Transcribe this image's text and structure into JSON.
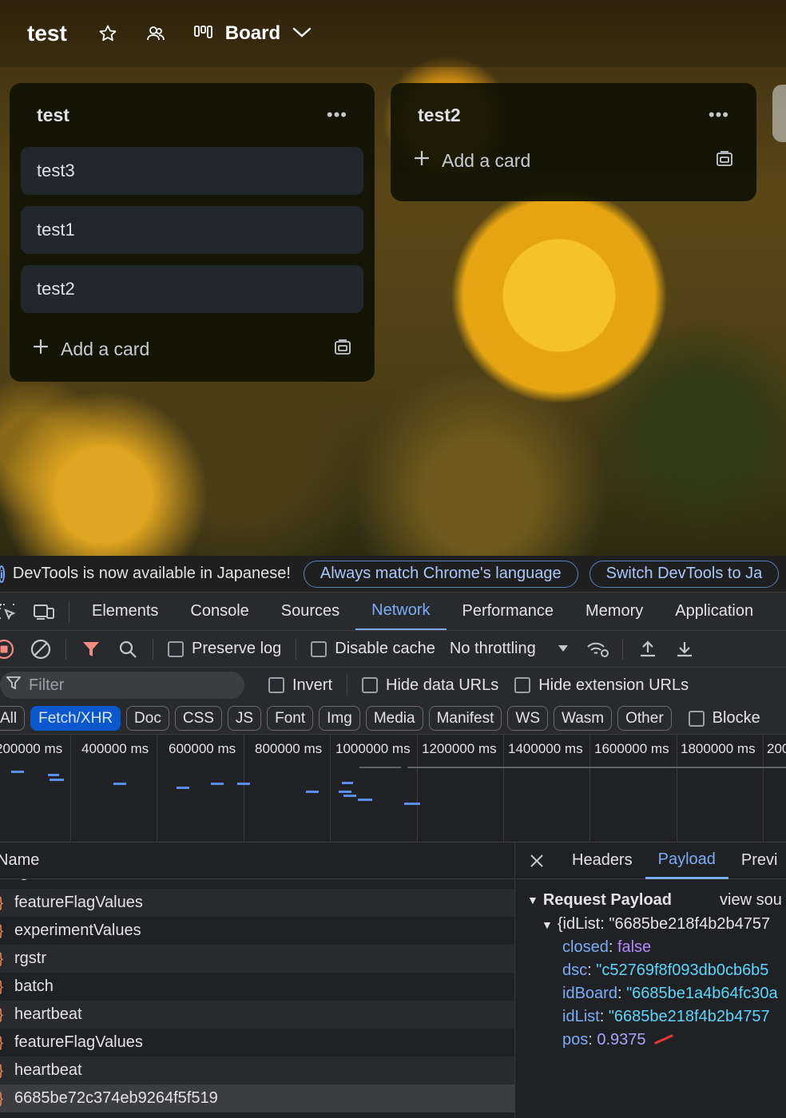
{
  "board": {
    "title": "test",
    "view_label": "Board",
    "lists": [
      {
        "title": "test",
        "cards": [
          "test3",
          "test1",
          "test2"
        ],
        "add_label": "Add a card"
      },
      {
        "title": "test2",
        "cards": [],
        "add_label": "Add a card"
      }
    ]
  },
  "devtools": {
    "info": {
      "message": "DevTools is now available in Japanese!",
      "btn1": "Always match Chrome's language",
      "btn2": "Switch DevTools to Ja"
    },
    "tabs": [
      "Elements",
      "Console",
      "Sources",
      "Network",
      "Performance",
      "Memory",
      "Application"
    ],
    "active_tab": "Network",
    "toolbar": {
      "preserve_log": "Preserve log",
      "disable_cache": "Disable cache",
      "throttling": "No throttling"
    },
    "filter": {
      "placeholder": "Filter",
      "invert": "Invert",
      "hide_data_urls": "Hide data URLs",
      "hide_extension_urls": "Hide extension URLs"
    },
    "types": [
      "All",
      "Fetch/XHR",
      "Doc",
      "CSS",
      "JS",
      "Font",
      "Img",
      "Media",
      "Manifest",
      "WS",
      "Wasm",
      "Other"
    ],
    "active_type": "Fetch/XHR",
    "blocked_label": "Blocke",
    "timeline_labels": [
      "200000 ms",
      "400000 ms",
      "600000 ms",
      "800000 ms",
      "1000000 ms",
      "1200000 ms",
      "1400000 ms",
      "1600000 ms",
      "1800000 ms",
      "200"
    ],
    "requests": {
      "name_header": "Name",
      "partial_row": "rgstr",
      "rows": [
        "featureFlagValues",
        "experimentValues",
        "rgstr",
        "batch",
        "heartbeat",
        "featureFlagValues",
        "heartbeat",
        "6685be72c374eb9264f5f519"
      ]
    },
    "detail": {
      "tabs": [
        "Headers",
        "Payload",
        "Previ"
      ],
      "active_tab": "Payload",
      "payload_title": "Request Payload",
      "view_source": "view sou",
      "root_line": "{idList: \"6685be218f4b2b4757",
      "fields": [
        {
          "key": "closed",
          "value": "false",
          "kind": "bool"
        },
        {
          "key": "dsc",
          "value": "\"c52769f8f093db0cb6b5",
          "kind": "str"
        },
        {
          "key": "idBoard",
          "value": "\"6685be1a4b64fc30a",
          "kind": "str"
        },
        {
          "key": "idList",
          "value": "\"6685be218f4b2b4757",
          "kind": "str"
        },
        {
          "key": "pos",
          "value": "0.9375",
          "kind": "num"
        }
      ]
    }
  },
  "colors": {
    "accent": "#7cacf8",
    "active_pill": "#0b57d0",
    "request_icon": "#f28b54",
    "string_value": "#5cd5fb"
  }
}
